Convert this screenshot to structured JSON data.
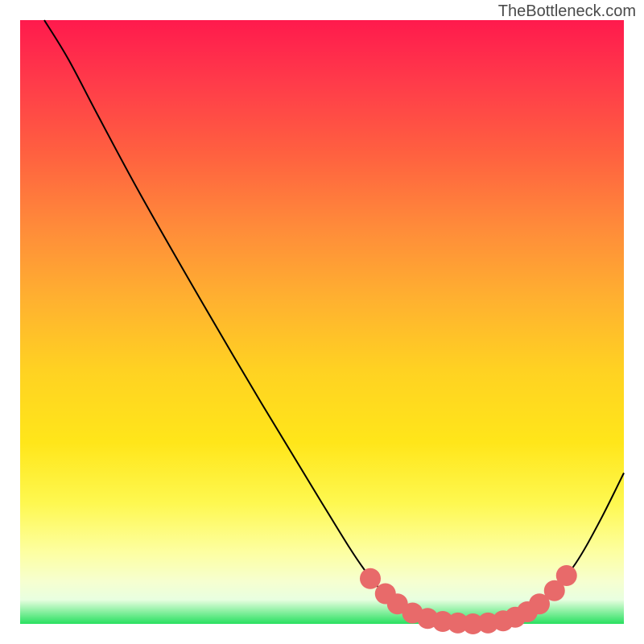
{
  "credit": "TheBottleneck.com",
  "chart_data": {
    "type": "line",
    "title": "",
    "xlabel": "",
    "ylabel": "",
    "xlim": [
      0,
      100
    ],
    "ylim": [
      0,
      100
    ],
    "curve": [
      {
        "x": 4.0,
        "y": 100.0
      },
      {
        "x": 8.0,
        "y": 93.5
      },
      {
        "x": 13.0,
        "y": 84.0
      },
      {
        "x": 20.0,
        "y": 71.0
      },
      {
        "x": 30.0,
        "y": 53.5
      },
      {
        "x": 40.0,
        "y": 36.5
      },
      {
        "x": 50.0,
        "y": 20.0
      },
      {
        "x": 57.0,
        "y": 9.0
      },
      {
        "x": 62.0,
        "y": 3.5
      },
      {
        "x": 66.0,
        "y": 1.3
      },
      {
        "x": 70.0,
        "y": 0.4
      },
      {
        "x": 75.0,
        "y": 0.0
      },
      {
        "x": 80.0,
        "y": 0.4
      },
      {
        "x": 84.0,
        "y": 1.8
      },
      {
        "x": 88.0,
        "y": 5.0
      },
      {
        "x": 92.0,
        "y": 10.0
      },
      {
        "x": 96.0,
        "y": 17.0
      },
      {
        "x": 100.0,
        "y": 25.0
      }
    ],
    "markers": [
      {
        "x": 58.0,
        "y": 7.5,
        "r": 1.2
      },
      {
        "x": 60.5,
        "y": 5.0,
        "r": 1.2
      },
      {
        "x": 62.5,
        "y": 3.3,
        "r": 1.2
      },
      {
        "x": 65.0,
        "y": 1.8,
        "r": 1.2
      },
      {
        "x": 67.5,
        "y": 0.9,
        "r": 1.2
      },
      {
        "x": 70.0,
        "y": 0.4,
        "r": 1.2
      },
      {
        "x": 72.5,
        "y": 0.15,
        "r": 1.2
      },
      {
        "x": 75.0,
        "y": 0.0,
        "r": 1.2
      },
      {
        "x": 77.5,
        "y": 0.15,
        "r": 1.2
      },
      {
        "x": 80.0,
        "y": 0.5,
        "r": 1.2
      },
      {
        "x": 82.0,
        "y": 1.1,
        "r": 1.2
      },
      {
        "x": 84.0,
        "y": 2.0,
        "r": 1.2
      },
      {
        "x": 86.0,
        "y": 3.3,
        "r": 1.2
      },
      {
        "x": 88.5,
        "y": 5.5,
        "r": 1.2
      },
      {
        "x": 90.5,
        "y": 8.0,
        "r": 1.2
      }
    ]
  }
}
